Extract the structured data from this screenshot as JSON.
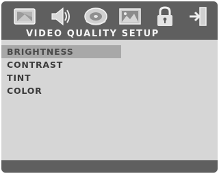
{
  "header": {
    "title": "VIDEO QUALITY SETUP",
    "icons": [
      {
        "name": "general-setup-icon"
      },
      {
        "name": "audio-speaker-icon"
      },
      {
        "name": "dolby-disc-icon"
      },
      {
        "name": "video-picture-icon"
      },
      {
        "name": "lock-icon"
      },
      {
        "name": "exit-icon"
      }
    ]
  },
  "menu": {
    "items": [
      {
        "label": "BRIGHTNESS",
        "selected": true
      },
      {
        "label": "CONTRAST",
        "selected": false
      },
      {
        "label": "TINT",
        "selected": false
      },
      {
        "label": "COLOR",
        "selected": false
      }
    ]
  },
  "colors": {
    "bar": "#5f5f5f",
    "panel": "#d6d6d6",
    "highlight": "#a8a8a8",
    "title_text": "#f4f4f4",
    "item_text": "#3a3a3a"
  }
}
